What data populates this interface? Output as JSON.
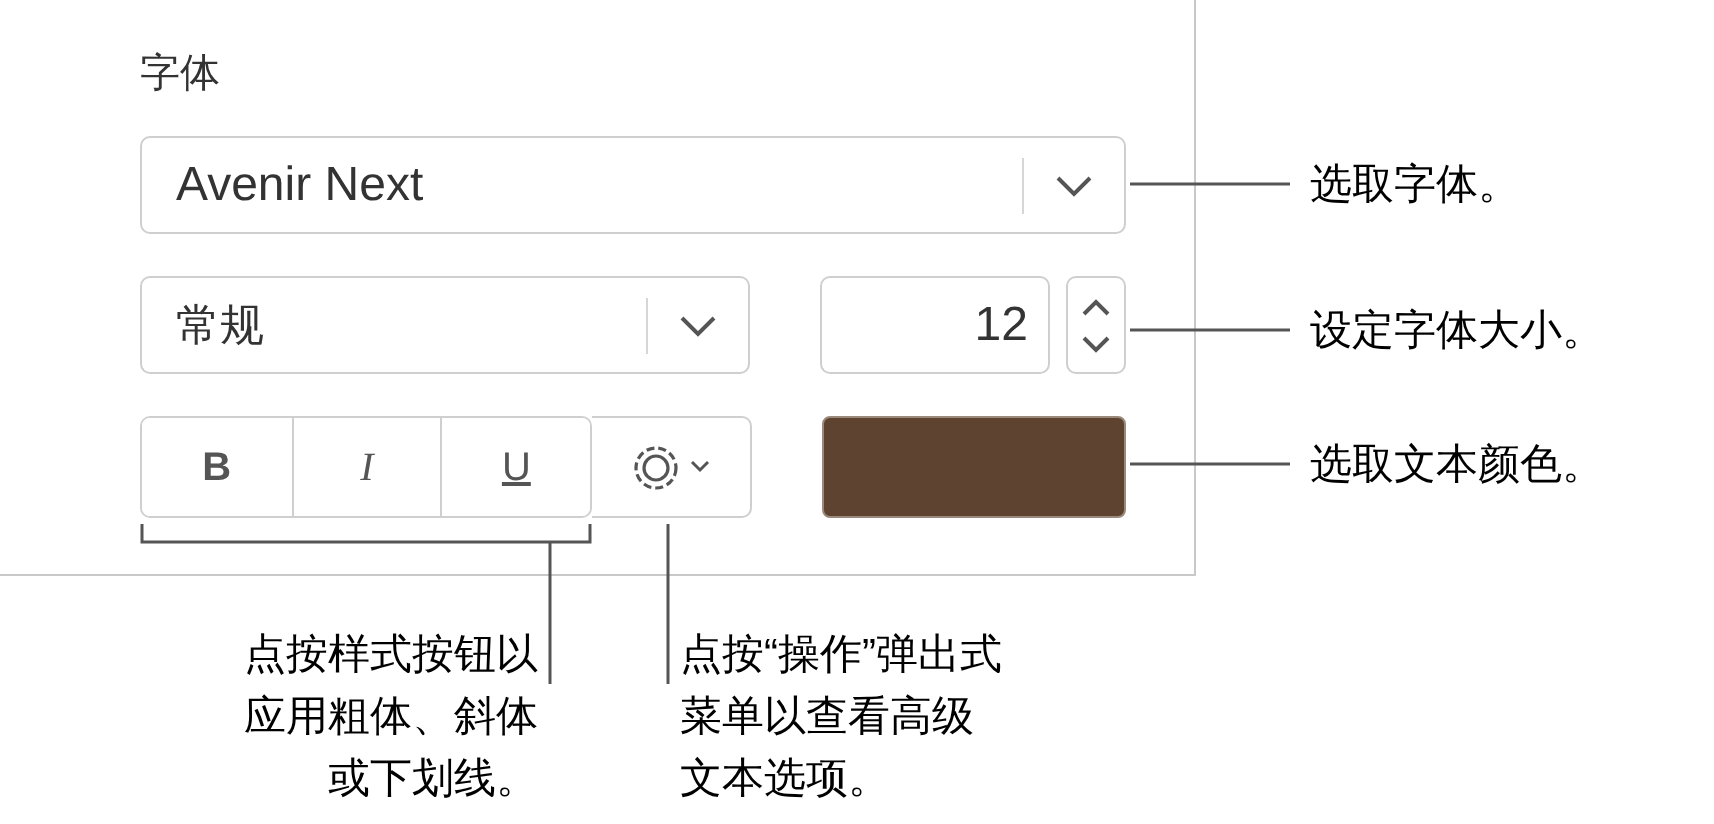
{
  "panel": {
    "section_label": "字体",
    "font_family": {
      "value": "Avenir Next"
    },
    "typeface": {
      "value": "常规"
    },
    "size": {
      "value": "12"
    },
    "style_buttons": [
      {
        "label": "B",
        "kind": "bold",
        "selected": false
      },
      {
        "label": "I",
        "kind": "italic",
        "selected": false
      },
      {
        "label": "U",
        "kind": "underline",
        "selected": false
      }
    ],
    "color_well": {
      "color": "#5e4430"
    }
  },
  "callouts": [
    "选取字体。",
    "设定字体大小。",
    "选取文本颜色。"
  ],
  "bottom_callouts": [
    {
      "lines": [
        "点按样式按钮以",
        "应用粗体、斜体",
        "或下划线。"
      ]
    },
    {
      "lines": [
        "点按“操作”弹出式",
        "菜单以查看高级",
        "文本选项。"
      ]
    }
  ]
}
